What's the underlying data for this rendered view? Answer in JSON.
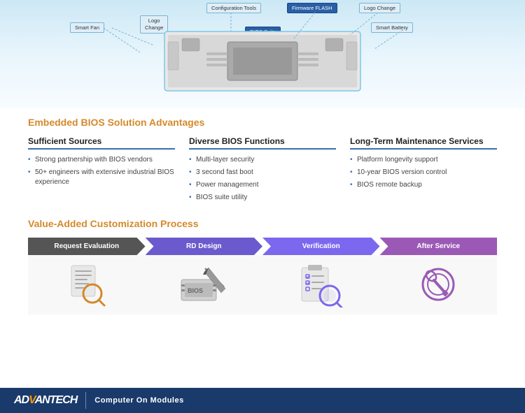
{
  "header": {
    "labels": {
      "smart_fan": "Smart Fan",
      "logo_change": "Logo\nChange",
      "bios_suite": "BIOS Suite",
      "smart_battery": "Smart Battery",
      "config_tools": "Configuration Tools",
      "firmware_flash": "Firmware FLASH",
      "logo_change2": "Logo Change"
    }
  },
  "section1": {
    "title": "Embedded BIOS Solution Advantages",
    "col1": {
      "heading": "Sufficient Sources",
      "items": [
        "Strong partnership with BIOS vendors",
        "50+ engineers with extensive industrial BIOS experience"
      ]
    },
    "col2": {
      "heading": "Diverse BIOS Functions",
      "items": [
        "Multi-layer security",
        "3 second fast boot",
        "Power management",
        "BIOS suite utility"
      ]
    },
    "col3": {
      "heading": "Long-Term Maintenance Services",
      "items": [
        "Platform longevity support",
        "10-year BIOS version control",
        "BIOS remote backup"
      ]
    }
  },
  "section2": {
    "title": "Value-Added Customization Process",
    "steps": [
      {
        "id": "step1",
        "label": "Request Evaluation",
        "icon": "📋",
        "bg": "step-bg-1",
        "shape": "first"
      },
      {
        "id": "step2",
        "label": "RD Design",
        "icon": "💾",
        "bg": "step-bg-2",
        "shape": "middle"
      },
      {
        "id": "step3",
        "label": "Verification",
        "icon": "🔍",
        "bg": "step-bg-3",
        "shape": "middle"
      },
      {
        "id": "step4",
        "label": "After Service",
        "icon": "🔧",
        "bg": "step-bg-4",
        "shape": "last"
      }
    ]
  },
  "footer": {
    "logo_prefix": "AD",
    "logo_highlight": "V",
    "logo_suffix": "ANTECH",
    "divider": "|",
    "tagline": "Computer On Modules"
  }
}
